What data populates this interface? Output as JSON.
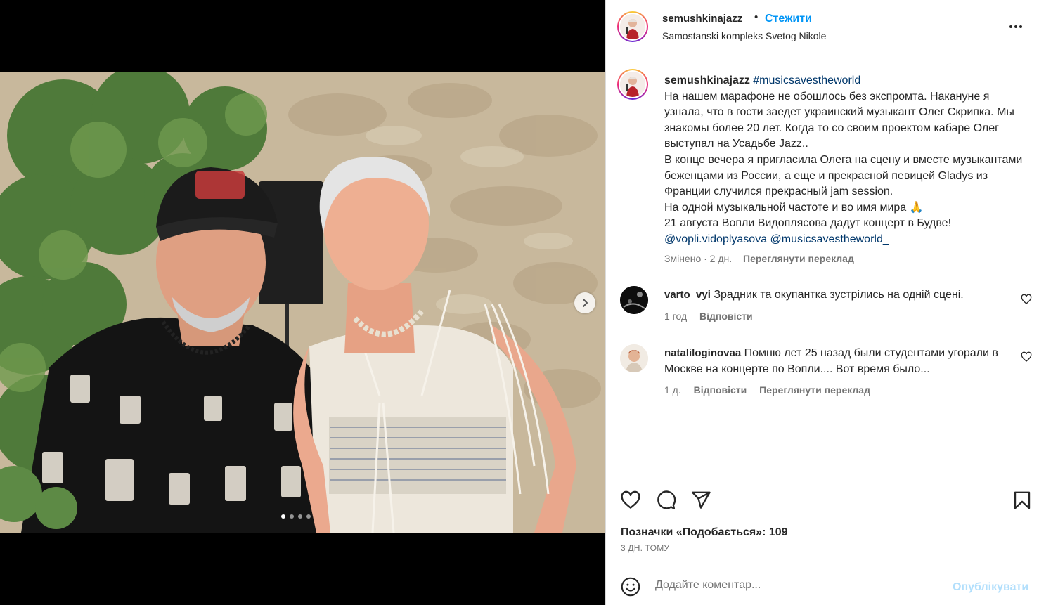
{
  "post": {
    "username": "semushkinajazz",
    "separator": "•",
    "follow_label": "Стежити",
    "location": "Samostanski kompleks Svetog Nikole",
    "caption": {
      "hashtag": "#musicsavestheworld",
      "lines": [
        "На нашем марафоне не обошлось без экспромта. Накануне я узнала, что в гости заедет украинский музыкант Олег Скрипка. Мы знакомы более 20 лет. Когда то со своим проектом кабаре Олег выступал на Усадьбе Jazz..",
        "В конце вечера я пригласила Олега на сцену и вместе музыкантами беженцами из России, а еще и прекрасной певицей Gladys из Франции случился прекрасный jam session.",
        "На одной музыкальной частоте и во имя мира 🙏",
        "21 августа Вопли Видоплясова дадут концерт в Будве!"
      ],
      "mention1": "@vopli.vidoplyasova",
      "mention2": "@musicsavestheworld_",
      "edited": "Змінено · 2 дн.",
      "see_translation": "Переглянути переклад"
    },
    "comments": [
      {
        "username": "varto_vyi",
        "text": "Зрадник та окупантка зустрілись на одній сцені.",
        "time": "1 год",
        "reply": "Відповісти"
      },
      {
        "username": "nataliloginovaa",
        "text": "Помню лет 25 назад были студентами угорали в Москве на концерте по Вопли.... Вот время было...",
        "time": "1 д.",
        "reply": "Відповісти",
        "see_translation": "Переглянути переклад"
      }
    ],
    "likes_text": "Позначки «Подобається»: 109",
    "timestamp": "3 ДН. ТОМУ",
    "comment_placeholder": "Додайте коментар...",
    "post_button": "Опублікувати",
    "carousel": {
      "total": 4,
      "active": 1
    }
  },
  "icons": {
    "like": "heart-icon",
    "comment": "comment-bubble-icon",
    "share": "paper-plane-icon",
    "save": "bookmark-icon",
    "emoji": "emoji-smiley-icon",
    "more": "more-options-icon",
    "next": "chevron-right-icon"
  },
  "colors": {
    "link_blue": "#0095f6",
    "mention": "#00376b",
    "muted": "#737373",
    "post_disabled": "#b2dffc"
  }
}
